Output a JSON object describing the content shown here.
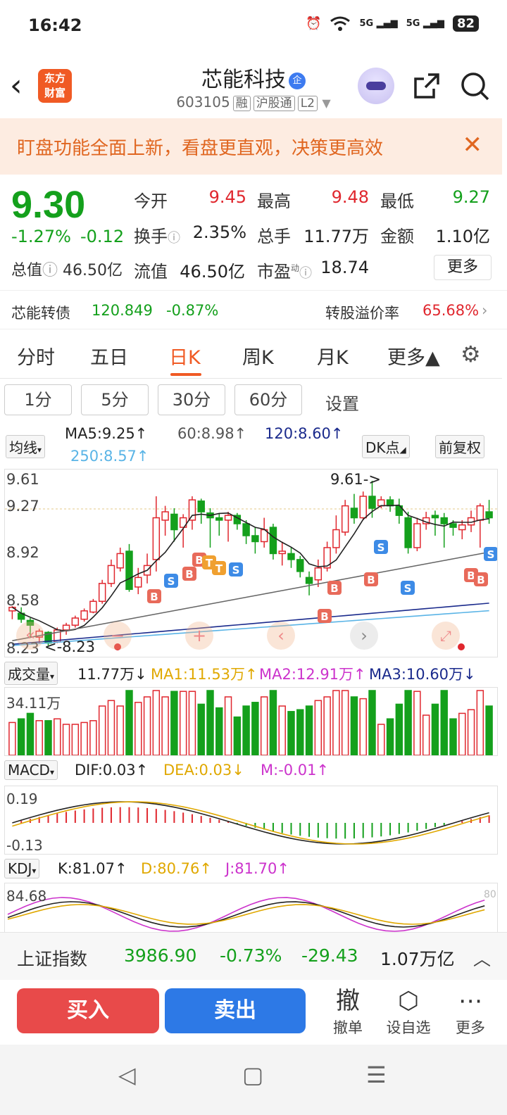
{
  "status": {
    "time": "16:42",
    "battery": "82",
    "sig1": "5G",
    "sig2": "5G"
  },
  "header": {
    "logo_line1": "东方",
    "logo_line2": "财富",
    "title": "芯能科技",
    "title_badge": "企",
    "code": "603105",
    "tags": [
      "融",
      "沪股通",
      "L2"
    ]
  },
  "banner": {
    "text": "盯盘功能全面上新，看盘更直观，决策更高效",
    "close": "✕"
  },
  "quote": {
    "price": "9.30",
    "change_pct": "-1.27%",
    "change": "-0.12",
    "market_cap_label": "总值",
    "market_cap": "46.50亿",
    "open_label": "今开",
    "open": "9.45",
    "high_label": "最高",
    "high": "9.48",
    "low_label": "最低",
    "low": "9.27",
    "turnover_label": "换手",
    "turnover": "2.35%",
    "volume_label": "总手",
    "volume": "11.77万",
    "amount_label": "金额",
    "amount": "1.10亿",
    "float_label": "流值",
    "float_cap": "46.50亿",
    "pe_label": "市盈",
    "pe_sup": "动",
    "pe": "18.74",
    "more": "更多"
  },
  "bond": {
    "name": "芯能转债",
    "price": "120.849",
    "pct": "-0.87%",
    "premium_label": "转股溢价率",
    "premium": "65.68%"
  },
  "tabs": [
    "分时",
    "五日",
    "日K",
    "周K",
    "月K",
    "更多▲"
  ],
  "periods": [
    "1分",
    "5分",
    "30分",
    "60分"
  ],
  "period_settings": "设置",
  "ma": {
    "selector": "均线",
    "ma5": "MA5:9.25↑",
    "ma60": "60:8.98↑",
    "ma120": "120:8.60↑",
    "ma250": "250:8.57↑",
    "dk_btn": "DK点",
    "adj_btn": "前复权",
    "ma5_color": "#222222",
    "ma60_color": "#666666",
    "ma120_color": "#1a2a8c",
    "ma250_color": "#5ab4e6"
  },
  "kchart": {
    "y_top": "9.61",
    "y_2": "9.27",
    "y_3": "8.92",
    "y_4": "8.58",
    "y_bottom": "8.23",
    "high_marker": "9.61->",
    "low_marker": "<-8.23"
  },
  "volume": {
    "selector": "成交量",
    "value": "11.77万↓",
    "ma1": "MA1:11.53万↑",
    "ma2": "MA2:12.91万↑",
    "ma3": "MA3:10.60万↓",
    "y_top": "34.11万"
  },
  "macd": {
    "selector": "MACD",
    "dif": "DIF:0.03↑",
    "dea": "DEA:0.03↓",
    "m": "M:-0.01↑",
    "y_top": "0.19",
    "y_bottom": "-0.13"
  },
  "kdj": {
    "selector": "KDJ",
    "k": "K:81.07↑",
    "d": "D:80.76↑",
    "j": "J:81.70↑",
    "y_top": "84.68",
    "y_right": "80"
  },
  "index": {
    "name": "上证指数",
    "value": "3986.90",
    "pct": "-0.73%",
    "change": "-29.43",
    "amount": "1.07万亿",
    "arrow": "︿"
  },
  "actions": {
    "buy": "买入",
    "sell": "卖出",
    "cancel_icon": "撤",
    "cancel": "撤单",
    "watch": "设自选",
    "more": "更多"
  },
  "chart_data": {
    "type": "candlestick",
    "ylim": [
      8.23,
      9.61
    ],
    "candles": [
      [
        8.52,
        8.55,
        8.45,
        8.56
      ],
      [
        8.5,
        8.45,
        8.42,
        8.55
      ],
      [
        8.44,
        8.4,
        8.3,
        8.46
      ],
      [
        8.3,
        8.35,
        8.25,
        8.37
      ],
      [
        8.34,
        8.25,
        8.23,
        8.35
      ],
      [
        8.26,
        8.36,
        8.25,
        8.38
      ],
      [
        8.36,
        8.4,
        8.32,
        8.42
      ],
      [
        8.4,
        8.46,
        8.38,
        8.48
      ],
      [
        8.45,
        8.52,
        8.43,
        8.54
      ],
      [
        8.51,
        8.6,
        8.5,
        8.62
      ],
      [
        8.6,
        8.75,
        8.58,
        8.78
      ],
      [
        8.75,
        8.9,
        8.72,
        8.95
      ],
      [
        8.88,
        9.0,
        8.85,
        9.05
      ],
      [
        9.02,
        8.7,
        8.68,
        9.08
      ],
      [
        8.72,
        8.8,
        8.66,
        8.88
      ],
      [
        8.82,
        8.9,
        8.75,
        9.0
      ],
      [
        8.95,
        9.3,
        8.85,
        9.48
      ],
      [
        9.28,
        9.35,
        9.15,
        9.4
      ],
      [
        9.33,
        9.2,
        9.1,
        9.38
      ],
      [
        9.22,
        9.3,
        9.05,
        9.33
      ],
      [
        9.28,
        9.45,
        9.2,
        9.48
      ],
      [
        9.44,
        9.35,
        9.25,
        9.46
      ],
      [
        9.34,
        9.3,
        9.05,
        9.38
      ],
      [
        9.3,
        9.28,
        9.15,
        9.34
      ],
      [
        9.28,
        9.32,
        9.1,
        9.35
      ],
      [
        9.32,
        9.25,
        9.2,
        9.34
      ],
      [
        9.25,
        9.15,
        9.08,
        9.28
      ],
      [
        9.15,
        9.1,
        9.0,
        9.22
      ],
      [
        9.1,
        9.2,
        9.05,
        9.3
      ],
      [
        9.22,
        9.0,
        8.95,
        9.25
      ],
      [
        9.0,
        9.02,
        8.9,
        9.1
      ],
      [
        9.0,
        8.95,
        8.88,
        9.05
      ],
      [
        8.95,
        8.85,
        8.8,
        8.98
      ],
      [
        8.8,
        8.75,
        8.65,
        8.85
      ],
      [
        8.78,
        8.88,
        8.72,
        8.95
      ],
      [
        8.88,
        9.05,
        8.85,
        9.1
      ],
      [
        9.05,
        9.2,
        9.0,
        9.32
      ],
      [
        9.18,
        9.4,
        9.15,
        9.45
      ],
      [
        9.38,
        9.3,
        9.25,
        9.5
      ],
      [
        9.3,
        9.48,
        9.28,
        9.52
      ],
      [
        9.48,
        9.38,
        9.3,
        9.61
      ],
      [
        9.4,
        9.45,
        9.38,
        9.48
      ],
      [
        9.45,
        9.4,
        9.35,
        9.48
      ],
      [
        9.4,
        9.32,
        9.25,
        9.46
      ],
      [
        9.3,
        9.05,
        9.0,
        9.35
      ],
      [
        9.05,
        9.25,
        9.02,
        9.3
      ],
      [
        9.25,
        9.3,
        9.2,
        9.35
      ],
      [
        9.32,
        9.3,
        9.15,
        9.36
      ],
      [
        9.3,
        9.25,
        9.05,
        9.34
      ],
      [
        9.25,
        9.22,
        9.15,
        9.28
      ],
      [
        9.2,
        9.24,
        9.12,
        9.28
      ],
      [
        9.24,
        9.3,
        9.18,
        9.36
      ],
      [
        9.28,
        9.4,
        9.05,
        9.42
      ],
      [
        9.35,
        9.3,
        9.25,
        9.45
      ]
    ]
  }
}
